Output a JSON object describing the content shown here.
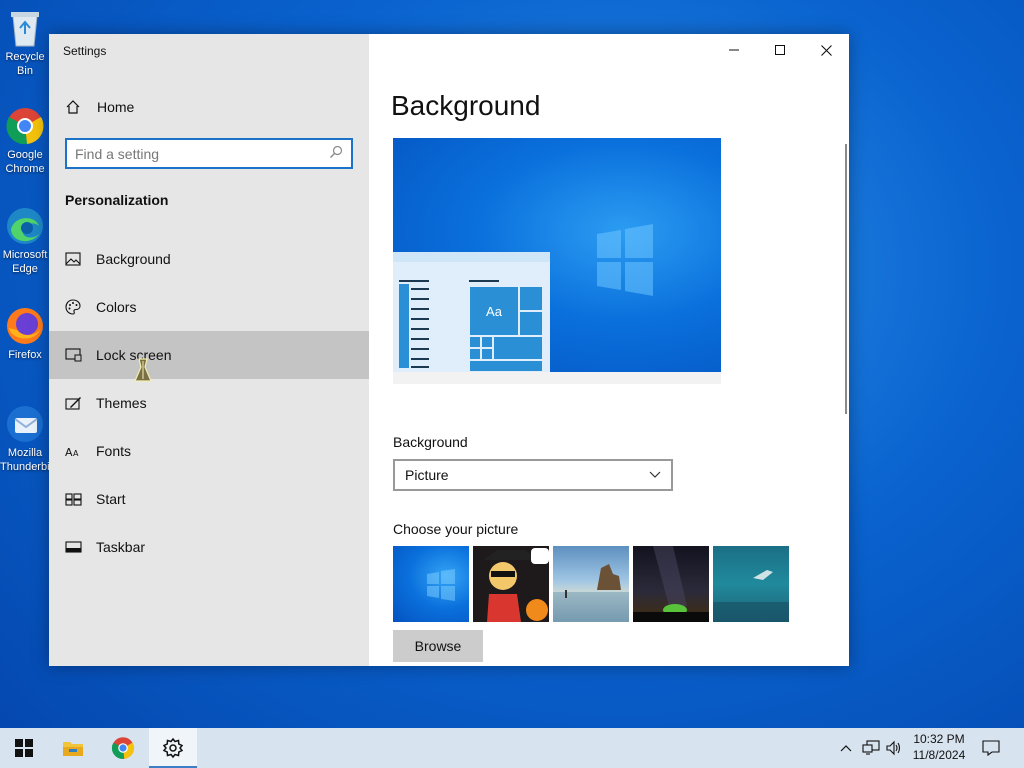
{
  "desktop": {
    "icons": [
      {
        "name": "recycle-bin",
        "label": "Recycle Bin"
      },
      {
        "name": "google-chrome",
        "label": "Google Chrome"
      },
      {
        "name": "microsoft-edge",
        "label": "Microsoft Edge"
      },
      {
        "name": "firefox",
        "label": "Firefox"
      },
      {
        "name": "mozilla-thunderbird",
        "label": "Mozilla Thunderbird"
      }
    ]
  },
  "window": {
    "title": "Settings",
    "home_label": "Home",
    "search_placeholder": "Find a setting",
    "section_title": "Personalization",
    "nav": [
      {
        "label": "Background",
        "icon": "picture-icon"
      },
      {
        "label": "Colors",
        "icon": "palette-icon"
      },
      {
        "label": "Lock screen",
        "icon": "lock-screen-icon",
        "active": true
      },
      {
        "label": "Themes",
        "icon": "themes-icon"
      },
      {
        "label": "Fonts",
        "icon": "fonts-icon"
      },
      {
        "label": "Start",
        "icon": "start-icon"
      },
      {
        "label": "Taskbar",
        "icon": "taskbar-icon"
      }
    ]
  },
  "content": {
    "page_title": "Background",
    "preview_tile_text": "Aa",
    "background_label": "Background",
    "background_value": "Picture",
    "choose_label": "Choose your picture",
    "browse_label": "Browse"
  },
  "taskbar": {
    "time": "10:32 PM",
    "date": "11/8/2024"
  },
  "colors": {
    "accent": "#1a73c8",
    "sidebar_bg": "#e6e6e6",
    "active_item_bg": "#c4c4c4",
    "taskbar_bg": "#d7e3ee"
  }
}
